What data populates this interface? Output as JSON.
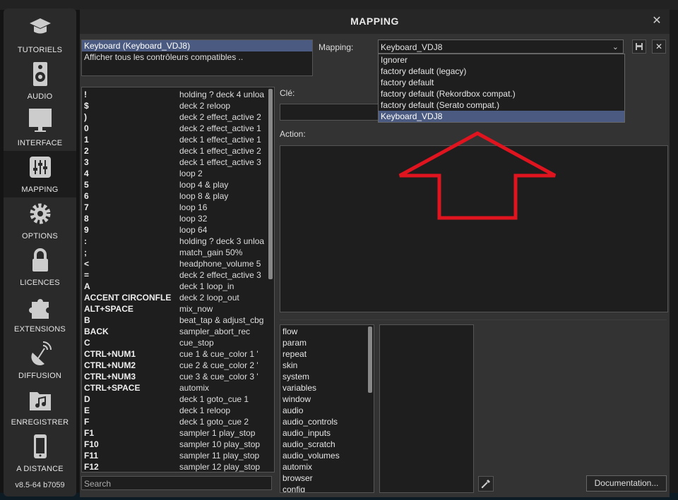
{
  "sidebar": {
    "items": [
      {
        "label": "TUTORIELS",
        "icon": "graduation-cap-icon"
      },
      {
        "label": "AUDIO",
        "icon": "speaker-icon"
      },
      {
        "label": "INTERFACE",
        "icon": "monitor-icon"
      },
      {
        "label": "MAPPING",
        "icon": "sliders-icon"
      },
      {
        "label": "OPTIONS",
        "icon": "gear-icon"
      },
      {
        "label": "LICENCES",
        "icon": "lock-icon"
      },
      {
        "label": "EXTENSIONS",
        "icon": "puzzle-icon"
      },
      {
        "label": "DIFFUSION",
        "icon": "satellite-dish-icon"
      },
      {
        "label": "ENREGISTRER",
        "icon": "music-folder-icon"
      },
      {
        "label": "A DISTANCE",
        "icon": "phone-icon"
      }
    ],
    "active_index": 3,
    "version": "v8.5-64 b7059"
  },
  "dialog": {
    "title": "MAPPING",
    "close": "✕"
  },
  "controllers": {
    "items": [
      "Keyboard (Keyboard_VDJ8)",
      "Afficher tous les contrôleurs compatibles .."
    ],
    "selected_index": 0
  },
  "mapping": {
    "label": "Mapping:",
    "value": "Keyboard_VDJ8",
    "save_icon": "save-icon",
    "delete_icon": "close-icon",
    "options": [
      "Ignorer",
      "factory default (legacy)",
      "factory default",
      "factory default (Rekordbox compat.)",
      "factory default (Serato compat.)",
      "Keyboard_VDJ8"
    ],
    "selected_option": 5
  },
  "keys": [
    {
      "key": "!",
      "action": "holding ? deck 4 unloa"
    },
    {
      "key": "$",
      "action": "deck 2 reloop"
    },
    {
      "key": ")",
      "action": "deck 2 effect_active 2"
    },
    {
      "key": "0",
      "action": "deck 2 effect_active 1"
    },
    {
      "key": "1",
      "action": "deck 1 effect_active 1"
    },
    {
      "key": "2",
      "action": "deck 1 effect_active 2"
    },
    {
      "key": "3",
      "action": "deck 1 effect_active 3"
    },
    {
      "key": "4",
      "action": "loop 2"
    },
    {
      "key": "5",
      "action": "loop 4 & play"
    },
    {
      "key": "6",
      "action": "loop 8 & play"
    },
    {
      "key": "7",
      "action": "loop 16"
    },
    {
      "key": "8",
      "action": "loop 32"
    },
    {
      "key": "9",
      "action": "loop 64"
    },
    {
      "key": ":",
      "action": "holding ? deck 3 unloa"
    },
    {
      "key": ";",
      "action": "match_gain 50%"
    },
    {
      "key": "<",
      "action": "headphone_volume 5"
    },
    {
      "key": "=",
      "action": "deck 2 effect_active 3"
    },
    {
      "key": "A",
      "action": "deck 1 loop_in"
    },
    {
      "key": "ACCENT CIRCONFLE",
      "action": "deck 2 loop_out"
    },
    {
      "key": "ALT+SPACE",
      "action": "mix_now"
    },
    {
      "key": "B",
      "action": "beat_tap & adjust_cbg"
    },
    {
      "key": "BACK",
      "action": "sampler_abort_rec"
    },
    {
      "key": "C",
      "action": "cue_stop"
    },
    {
      "key": "CTRL+NUM1",
      "action": "cue 1 & cue_color 1 '"
    },
    {
      "key": "CTRL+NUM2",
      "action": "cue 2 & cue_color 2 '"
    },
    {
      "key": "CTRL+NUM3",
      "action": "cue 3 & cue_color 3 '"
    },
    {
      "key": "CTRL+SPACE",
      "action": "automix"
    },
    {
      "key": "D",
      "action": "deck 1 goto_cue 1"
    },
    {
      "key": "E",
      "action": "deck 1 reloop"
    },
    {
      "key": "F",
      "action": "deck 1 goto_cue 2"
    },
    {
      "key": "F1",
      "action": "sampler 1 play_stop"
    },
    {
      "key": "F10",
      "action": "sampler  10 play_stop"
    },
    {
      "key": "F11",
      "action": "sampler  11 play_stop"
    },
    {
      "key": "F12",
      "action": "sampler  12 play_stop"
    }
  ],
  "search": {
    "placeholder": "Search"
  },
  "key_field": {
    "label": "Clé:"
  },
  "action_field": {
    "label": "Action:"
  },
  "categories": [
    "flow",
    "param",
    "repeat",
    "skin",
    "system",
    "variables",
    "window",
    "audio",
    "audio_controls",
    "audio_inputs",
    "audio_scratch",
    "audio_volumes",
    "automix",
    "browser",
    "config"
  ],
  "picker_icon": "eyedropper-icon",
  "documentation": {
    "label": "Documentation..."
  },
  "annotation": {
    "color": "#e0141e",
    "icon": "up-arrow-annotation"
  },
  "colors": {
    "selection": "#4a5a80",
    "panel": "#333333",
    "field": "#1e1e1e"
  }
}
